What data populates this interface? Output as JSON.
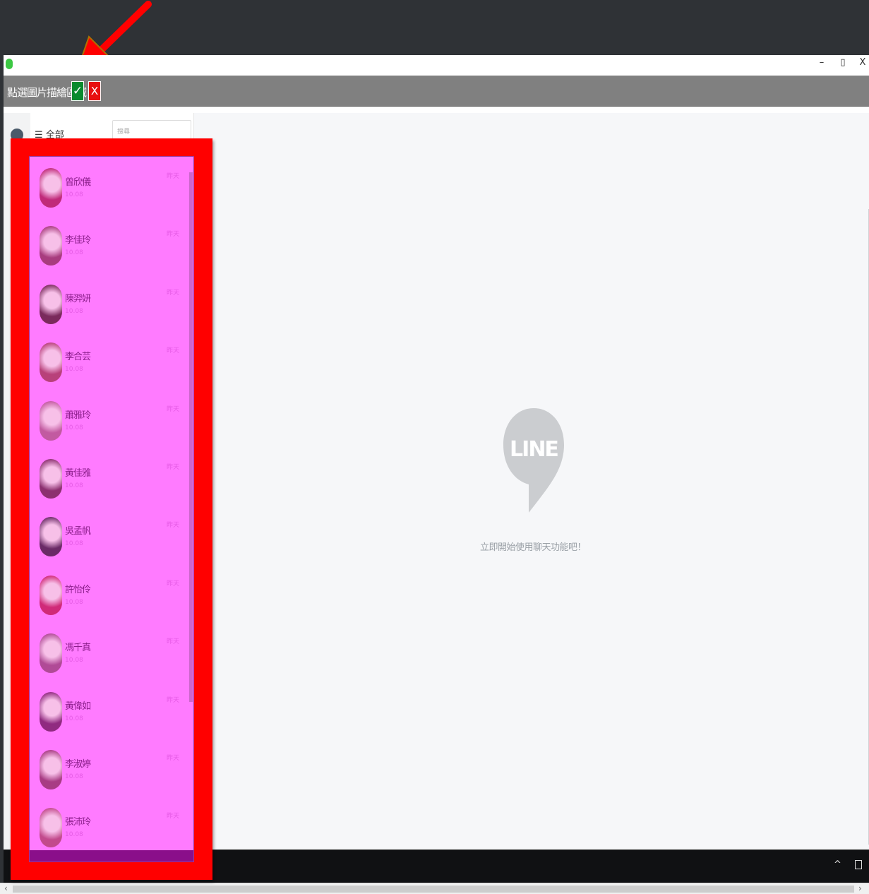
{
  "window": {
    "minimize": "–",
    "maximize": "▯",
    "close": "X"
  },
  "toolbar": {
    "label": "點選圖片描繪區域",
    "confirm": "✓",
    "cancel": "X"
  },
  "sidebar": {
    "filter": "☰ 全部",
    "search_placeholder": "搜尋"
  },
  "chats": [
    {
      "name": "曾欣儀",
      "preview": "10.08",
      "time": "昨天",
      "avatar_color": "#c02a7a"
    },
    {
      "name": "李佳玲",
      "preview": "10.08",
      "time": "昨天",
      "avatar_color": "#a83c7e"
    },
    {
      "name": "陳羿妍",
      "preview": "10.08",
      "time": "昨天",
      "avatar_color": "#7a2a5c"
    },
    {
      "name": "李合芸",
      "preview": "10.08",
      "time": "昨天",
      "avatar_color": "#b8407a"
    },
    {
      "name": "蕭雅玲",
      "preview": "10.08",
      "time": "昨天",
      "avatar_color": "#c25aa0"
    },
    {
      "name": "黃佳雅",
      "preview": "10.08",
      "time": "昨天",
      "avatar_color": "#8c3070"
    },
    {
      "name": "吳孟帆",
      "preview": "10.08",
      "time": "昨天",
      "avatar_color": "#6a2a66"
    },
    {
      "name": "許怡伶",
      "preview": "10.08",
      "time": "昨天",
      "avatar_color": "#d02a78"
    },
    {
      "name": "馮千真",
      "preview": "10.08",
      "time": "昨天",
      "avatar_color": "#b04a96"
    },
    {
      "name": "黃偉如",
      "preview": "10.08",
      "time": "昨天",
      "avatar_color": "#902a80"
    },
    {
      "name": "李淑婷",
      "preview": "10.08",
      "time": "昨天",
      "avatar_color": "#a83c84"
    },
    {
      "name": "張沛玲",
      "preview": "10.08",
      "time": "昨天",
      "avatar_color": "#c24a8c"
    }
  ],
  "main": {
    "logo_text": "LINE",
    "empty_message": "立即開始使用聊天功能吧！"
  },
  "taskbar": {
    "tray_up": "^"
  },
  "scrollbar": {
    "left": "‹",
    "right": "›"
  },
  "colors": {
    "annotation": "#ff0000",
    "selection_overlay": "#ff7bff",
    "confirm_green": "#0a8a2e",
    "cancel_red": "#e81010"
  }
}
